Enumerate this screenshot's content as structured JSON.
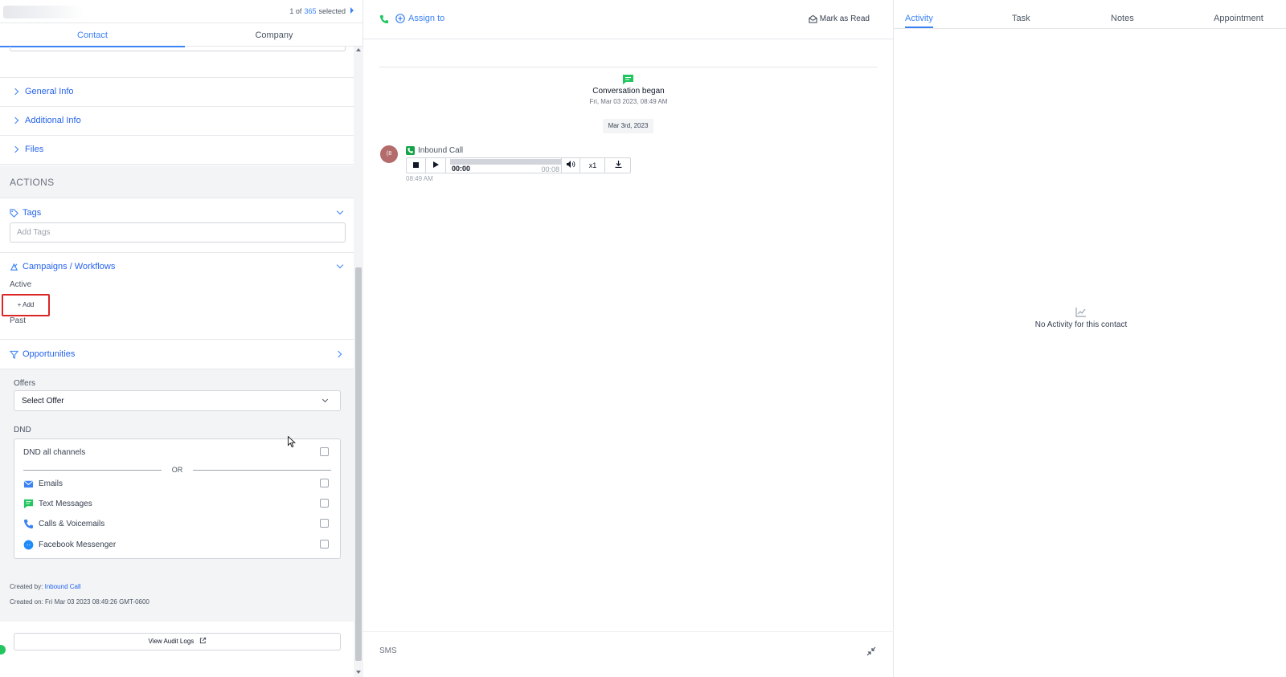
{
  "header": {
    "selection": {
      "prefix": "1 of",
      "count": "365",
      "suffix": "selected"
    }
  },
  "left_tabs": [
    "Contact",
    "Company"
  ],
  "accordions": [
    "General Info",
    "Additional Info",
    "Files"
  ],
  "actions": {
    "title": "ACTIONS",
    "tags": {
      "label": "Tags",
      "placeholder": "Add Tags"
    },
    "campaigns": {
      "label": "Campaigns / Workflows",
      "active_label": "Active",
      "add_label": "+ Add",
      "past_label": "Past"
    },
    "opportunities": {
      "label": "Opportunities"
    }
  },
  "offers": {
    "label": "Offers",
    "selected": "Select Offer"
  },
  "dnd": {
    "label": "DND",
    "all_channels": "DND all channels",
    "or_text": "OR",
    "channels": [
      {
        "label": "Emails",
        "icon": "email-icon"
      },
      {
        "label": "Text Messages",
        "icon": "sms-icon"
      },
      {
        "label": "Calls & Voicemails",
        "icon": "phone-icon"
      },
      {
        "label": "Facebook Messenger",
        "icon": "messenger-icon"
      }
    ]
  },
  "meta": {
    "created_by_label": "Created by:",
    "created_by_value": "Inbound Call",
    "created_on": "Created on: Fri Mar 03 2023 08:49:26 GMT-0600"
  },
  "audit_label": "View Audit Logs",
  "conversation": {
    "assign_label": "Assign to",
    "mark_read_label": "Mark as Read",
    "began_title": "Conversation began",
    "began_date": "Fri, Mar 03 2023, 08:49 AM",
    "date_pill": "Mar 3rd, 2023",
    "avatar_initials": "(8",
    "call": {
      "title": "Inbound Call",
      "current_time": "00:00",
      "duration": "00:08",
      "speed": "x1",
      "time": "08:49 AM"
    },
    "composer_label": "SMS"
  },
  "right_tabs": [
    "Activity",
    "Task",
    "Notes",
    "Appointment"
  ],
  "empty_activity": "No Activity for this contact",
  "colors": {
    "accent": "#3b82f6",
    "highlight": "#dc2626",
    "green": "#22c55e",
    "avatar": "#b36b6b"
  }
}
